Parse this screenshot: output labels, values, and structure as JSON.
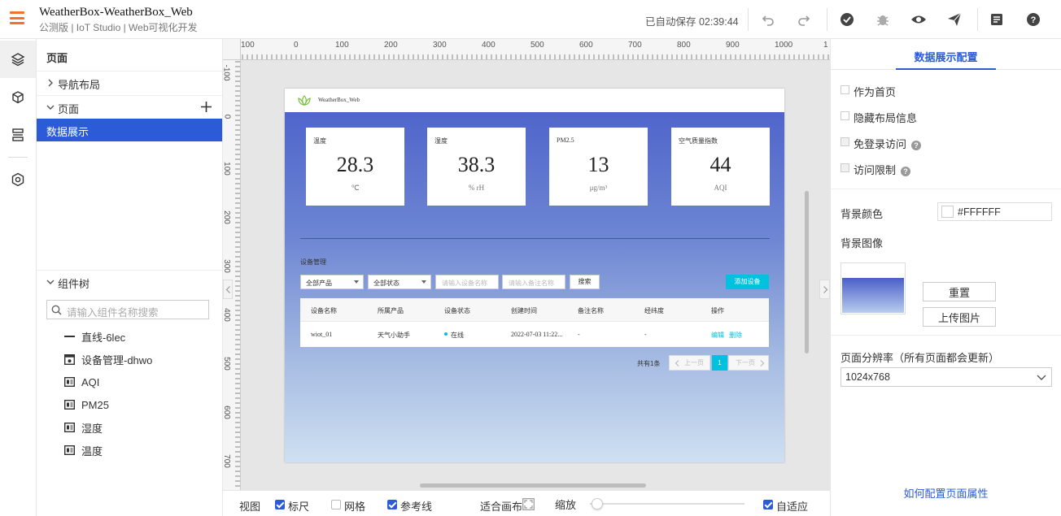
{
  "header": {
    "app_title": "WeatherBox-WeatherBox_Web",
    "app_subtitle": "公测版 | IoT Studio | Web可视化开发",
    "autosave": "已自动保存 02:39:44"
  },
  "left_panel": {
    "title": "页面",
    "nav_layout": "导航布局",
    "pages_label": "页面",
    "active_page": "数据展示",
    "component_tree_label": "组件树",
    "search_placeholder": "请输入组件名称搜索",
    "components": [
      "直线-6lec",
      "设备管理-dhwo",
      "AQI",
      "PM25",
      "湿度",
      "温度"
    ]
  },
  "rulers": {
    "top": [
      "100",
      "0",
      "100",
      "200",
      "300",
      "400",
      "500",
      "600",
      "700",
      "800",
      "900",
      "1000",
      "1"
    ],
    "left": [
      "-100",
      "0",
      "100",
      "200",
      "300",
      "400",
      "500",
      "600",
      "700"
    ]
  },
  "page_preview": {
    "site_name": "WeatherBox_Web",
    "cards": [
      {
        "label": "温度",
        "value": "28.3",
        "unit": "℃"
      },
      {
        "label": "湿度",
        "value": "38.3",
        "unit": "% rH"
      },
      {
        "label": "PM2.5",
        "value": "13",
        "unit": "μg/m³"
      },
      {
        "label": "空气质量指数",
        "value": "44",
        "unit": "AQI"
      }
    ],
    "device_section_title": "设备管理",
    "filter_product": "全部产品",
    "filter_status": "全部状态",
    "device_name_placeholder": "请输入设备名称",
    "remark_placeholder": "请输入备注名称",
    "search_button": "搜索",
    "add_device_button": "添加设备",
    "table_headers": [
      "设备名称",
      "所属产品",
      "设备状态",
      "创建时间",
      "备注名称",
      "经纬度",
      "操作"
    ],
    "table_row": {
      "name": "wiot_01",
      "product": "天气小助手",
      "status": "在线",
      "created": "2022-07-03 11:22...",
      "remark": "-",
      "coords": "-",
      "edit": "编辑",
      "delete": "删除"
    },
    "pagination": {
      "total": "共有1条",
      "prev": "上一页",
      "page": "1",
      "next": "下一页"
    }
  },
  "bottom_bar": {
    "view_label": "视图",
    "ruler_label": "标尺",
    "grid_label": "网格",
    "guides_label": "参考线",
    "fit_canvas_label": "适合画布",
    "zoom_label": "缩放",
    "auto_fit_label": "自适应",
    "ruler_checked": true,
    "grid_checked": false,
    "guides_checked": true,
    "auto_fit_checked": true
  },
  "right_panel": {
    "title": "数据展示配置",
    "home_page": "作为首页",
    "hide_layout": "隐藏布局信息",
    "no_login": "免登录访问",
    "access_limit": "访问限制",
    "bg_color_label": "背景颜色",
    "bg_color_value": "#FFFFFF",
    "bg_image_label": "背景图像",
    "reset_button": "重置",
    "upload_button": "上传图片",
    "resolution_label": "页面分辨率（所有页面都会更新）",
    "resolution_value": "1024x768",
    "help_link": "如何配置页面属性"
  },
  "colors": {
    "accent": "#2b5bd7",
    "menu_orange": "#f5712a",
    "add_button": "#00c1de"
  }
}
